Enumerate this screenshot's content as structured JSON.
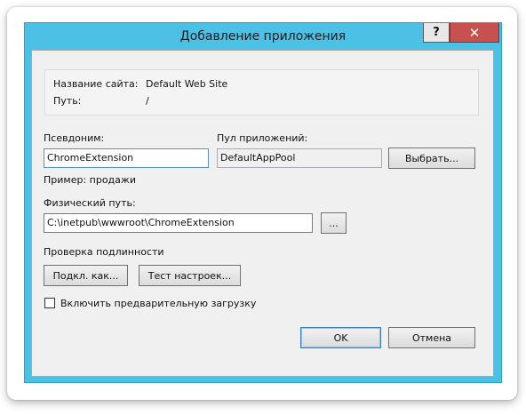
{
  "dialog": {
    "title": "Добавление приложения",
    "help_label": "?",
    "close_label": "✕"
  },
  "site_info": {
    "site_name_label": "Название сайта:",
    "site_name_value": "Default Web Site",
    "path_label": "Путь:",
    "path_value": "/"
  },
  "alias": {
    "label": "Псевдоним:",
    "value": "ChromeExtension",
    "example": "Пример: продажи"
  },
  "app_pool": {
    "label": "Пул приложений:",
    "value": "DefaultAppPool",
    "select_button": "Выбрать..."
  },
  "physical_path": {
    "label": "Физический путь:",
    "value": "C:\\inetpub\\wwwroot\\ChromeExtension",
    "browse_button": "..."
  },
  "auth": {
    "label": "Проверка подлинности",
    "connect_as_button": "Подкл. как...",
    "test_settings_button": "Тест настроек..."
  },
  "preload": {
    "label": "Включить предварительную загрузку",
    "checked": false
  },
  "footer": {
    "ok_button": "OK",
    "cancel_button": "Отмена"
  }
}
